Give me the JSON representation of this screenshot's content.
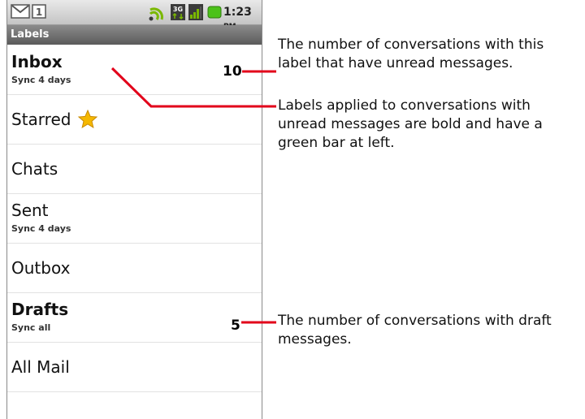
{
  "status_bar": {
    "time": "1:23",
    "ampm": "PM",
    "icons": [
      "gmail-icon",
      "notification-1-icon",
      "sync-icon",
      "3g-icon",
      "signal-icon",
      "battery-icon"
    ]
  },
  "title_bar": {
    "title": "Labels"
  },
  "labels": [
    {
      "name": "Inbox",
      "sync": "Sync 4 days",
      "bold": true
    },
    {
      "name": "Starred",
      "sync": "",
      "bold": false
    },
    {
      "name": "Chats",
      "sync": "",
      "bold": false
    },
    {
      "name": "Sent",
      "sync": "Sync 4 days",
      "bold": false
    },
    {
      "name": "Outbox",
      "sync": "",
      "bold": false
    },
    {
      "name": "Drafts",
      "sync": "Sync all",
      "bold": true
    },
    {
      "name": "All Mail",
      "sync": "",
      "bold": false
    }
  ],
  "counts": {
    "inbox": "10",
    "drafts": "5"
  },
  "callouts": {
    "unread_count": "The number of conversations with this label that have unread messages.",
    "bold_labels": "Labels applied to conversations with unread messages are bold and have a green bar at left.",
    "draft_count": "The number of conversations with draft messages."
  },
  "colors": {
    "leader_line": "#e2001a",
    "star": "#f5b800",
    "battery": "#4cc21a"
  }
}
